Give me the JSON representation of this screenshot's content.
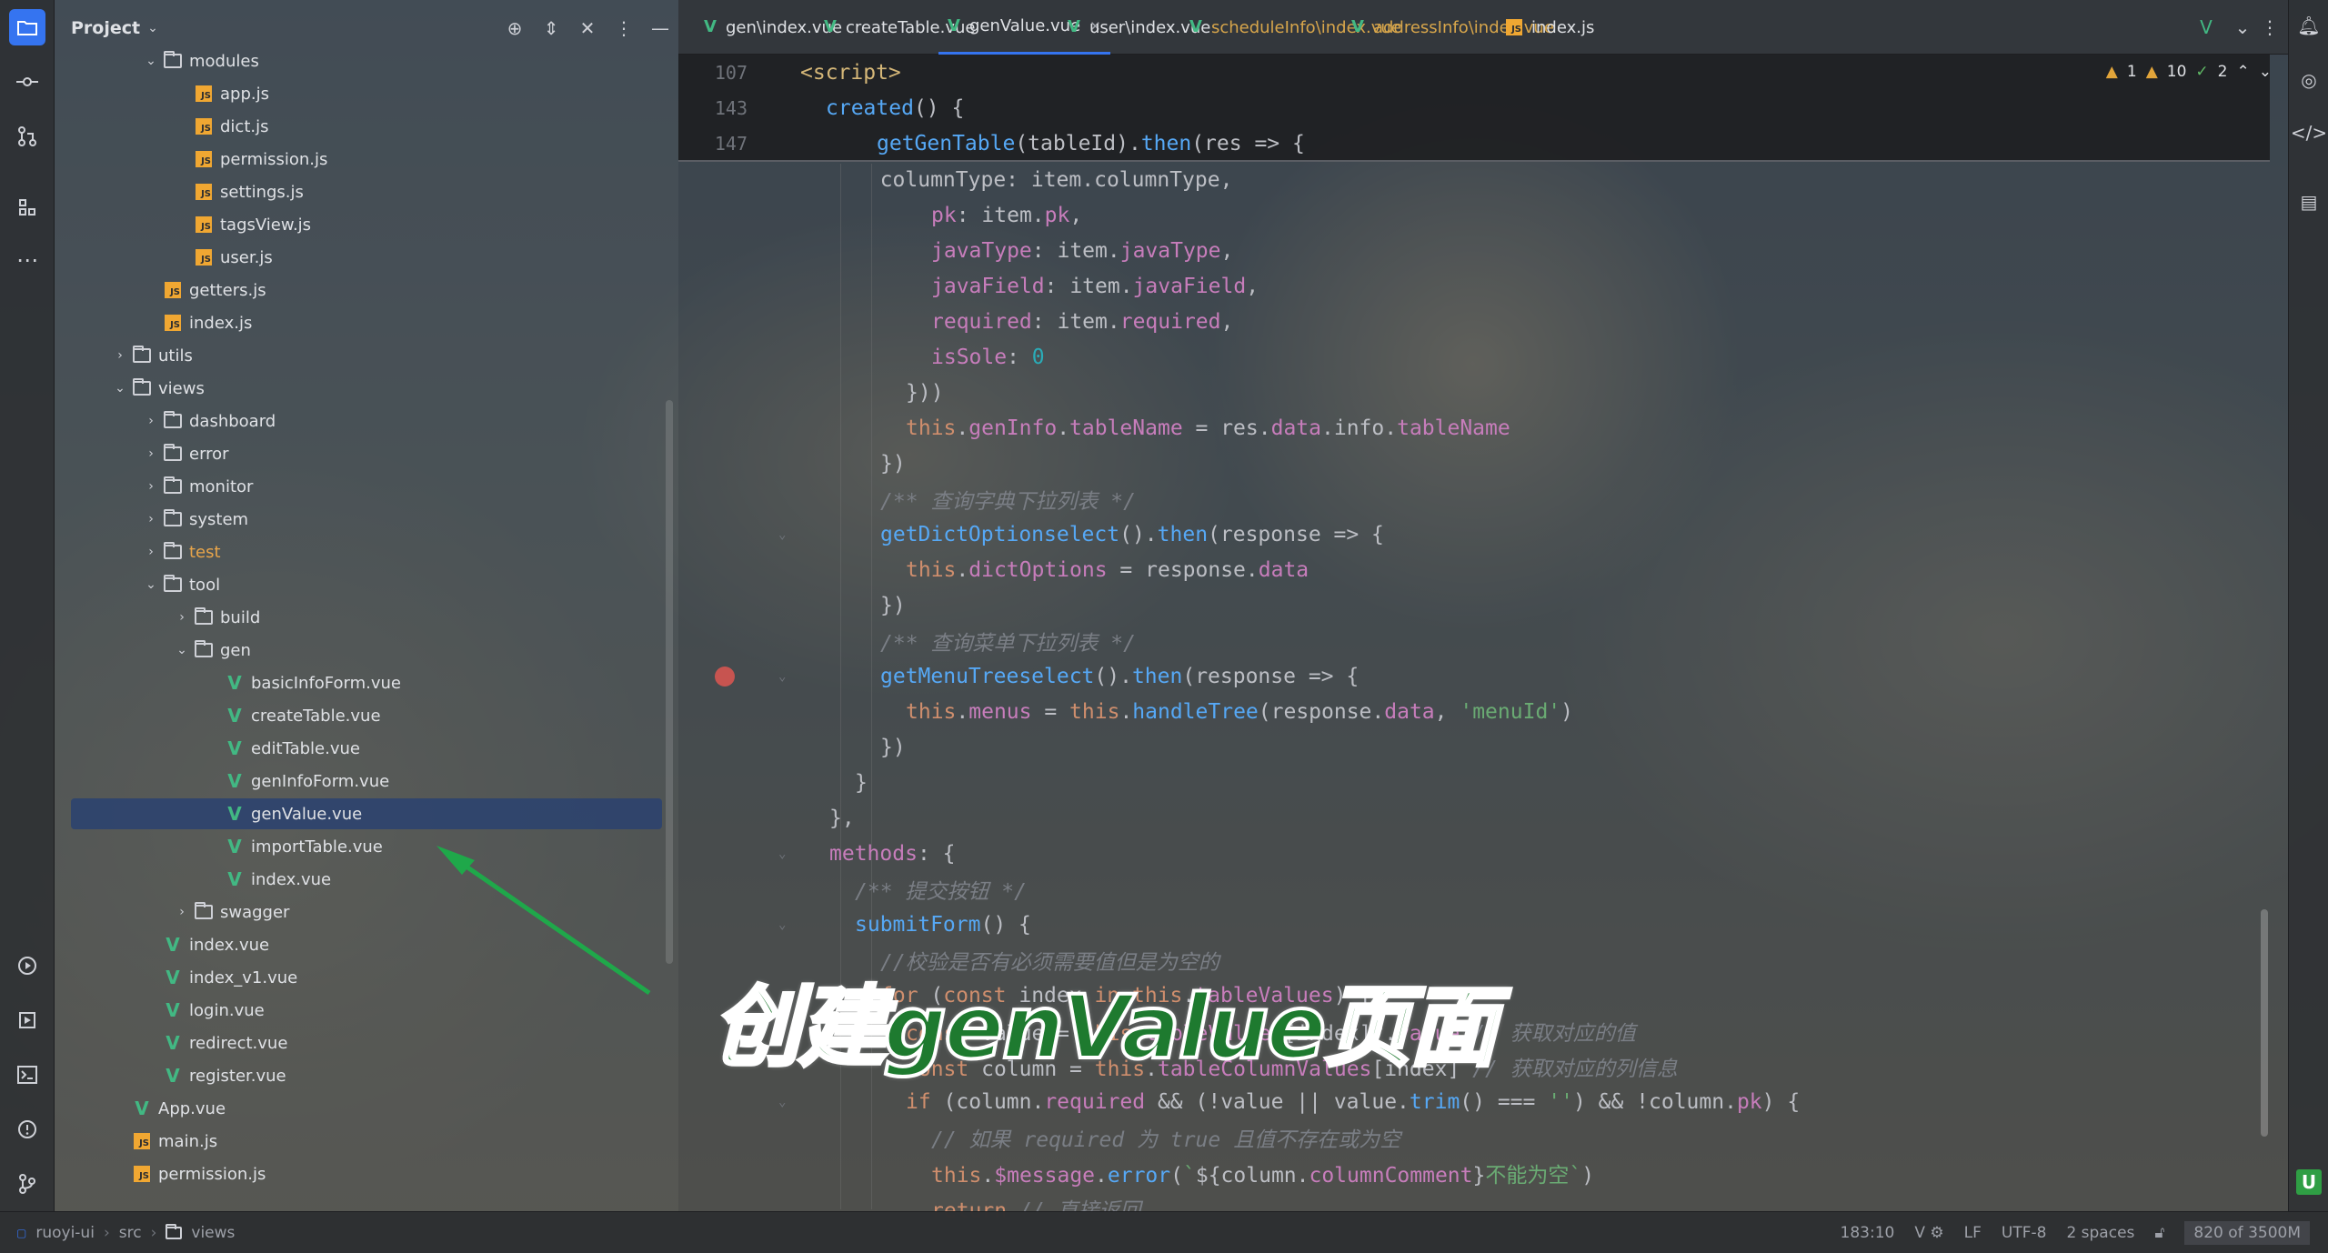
{
  "project_panel": {
    "title": "Project",
    "tree": [
      {
        "label": "modules",
        "type": "folder",
        "depth": 2,
        "expanded": true
      },
      {
        "label": "app.js",
        "type": "js",
        "depth": 3
      },
      {
        "label": "dict.js",
        "type": "js",
        "depth": 3
      },
      {
        "label": "permission.js",
        "type": "js",
        "depth": 3
      },
      {
        "label": "settings.js",
        "type": "js",
        "depth": 3
      },
      {
        "label": "tagsView.js",
        "type": "js",
        "depth": 3
      },
      {
        "label": "user.js",
        "type": "js",
        "depth": 3
      },
      {
        "label": "getters.js",
        "type": "js",
        "depth": 2
      },
      {
        "label": "index.js",
        "type": "js",
        "depth": 2
      },
      {
        "label": "utils",
        "type": "folder",
        "depth": 1,
        "expanded": false
      },
      {
        "label": "views",
        "type": "folder",
        "depth": 1,
        "expanded": true
      },
      {
        "label": "dashboard",
        "type": "folder",
        "depth": 2,
        "expanded": false
      },
      {
        "label": "error",
        "type": "folder",
        "depth": 2,
        "expanded": false
      },
      {
        "label": "monitor",
        "type": "folder",
        "depth": 2,
        "expanded": false
      },
      {
        "label": "system",
        "type": "folder",
        "depth": 2,
        "expanded": false
      },
      {
        "label": "test",
        "type": "folder",
        "depth": 2,
        "expanded": false,
        "modified": true
      },
      {
        "label": "tool",
        "type": "folder",
        "depth": 2,
        "expanded": true
      },
      {
        "label": "build",
        "type": "folder",
        "depth": 3,
        "expanded": false
      },
      {
        "label": "gen",
        "type": "folder",
        "depth": 3,
        "expanded": true
      },
      {
        "label": "basicInfoForm.vue",
        "type": "vue",
        "depth": 4
      },
      {
        "label": "createTable.vue",
        "type": "vue",
        "depth": 4
      },
      {
        "label": "editTable.vue",
        "type": "vue",
        "depth": 4
      },
      {
        "label": "genInfoForm.vue",
        "type": "vue",
        "depth": 4
      },
      {
        "label": "genValue.vue",
        "type": "vue",
        "depth": 4,
        "selected": true
      },
      {
        "label": "importTable.vue",
        "type": "vue",
        "depth": 4
      },
      {
        "label": "index.vue",
        "type": "vue",
        "depth": 4
      },
      {
        "label": "swagger",
        "type": "folder",
        "depth": 3,
        "expanded": false
      },
      {
        "label": "index.vue",
        "type": "vue",
        "depth": 2
      },
      {
        "label": "index_v1.vue",
        "type": "vue",
        "depth": 2
      },
      {
        "label": "login.vue",
        "type": "vue",
        "depth": 2
      },
      {
        "label": "redirect.vue",
        "type": "vue",
        "depth": 2
      },
      {
        "label": "register.vue",
        "type": "vue",
        "depth": 2
      },
      {
        "label": "App.vue",
        "type": "vue",
        "depth": 1
      },
      {
        "label": "main.js",
        "type": "js",
        "depth": 1
      },
      {
        "label": "permission.js",
        "type": "js",
        "depth": 1
      }
    ]
  },
  "tabs": [
    {
      "label": "gen\\index.vue",
      "icon": "vue-icon"
    },
    {
      "label": "createTable.vue",
      "icon": "vue-icon"
    },
    {
      "label": "genValue.vue",
      "icon": "vue-icon",
      "active": true
    },
    {
      "label": "user\\index.vue",
      "icon": "vue-icon"
    },
    {
      "label": "scheduleInfo\\index.vue",
      "icon": "vue-icon",
      "modified": true
    },
    {
      "label": "addressInfo\\index.vue",
      "icon": "vue-icon",
      "modified": true
    },
    {
      "label": "index.js",
      "icon": "js-icon"
    }
  ],
  "inspections": {
    "warnings_a": "1",
    "warnings_b": "10",
    "ok": "2"
  },
  "sticky_lines": [
    {
      "num": "107"
    },
    {
      "num": "143"
    },
    {
      "num": "147"
    }
  ],
  "caption": "创建genValue页面",
  "statusbar": {
    "breadcrumb": [
      "ruoyi-ui",
      "src",
      "views"
    ],
    "position": "183:10",
    "line_ending": "LF",
    "encoding": "UTF-8",
    "indent": "2 spaces",
    "memory": "820 of 3500M"
  },
  "colors": {
    "accent": "#3574f0",
    "vue": "#42b883",
    "js": "#f0a732",
    "caption_green": "#1e7a2f"
  }
}
